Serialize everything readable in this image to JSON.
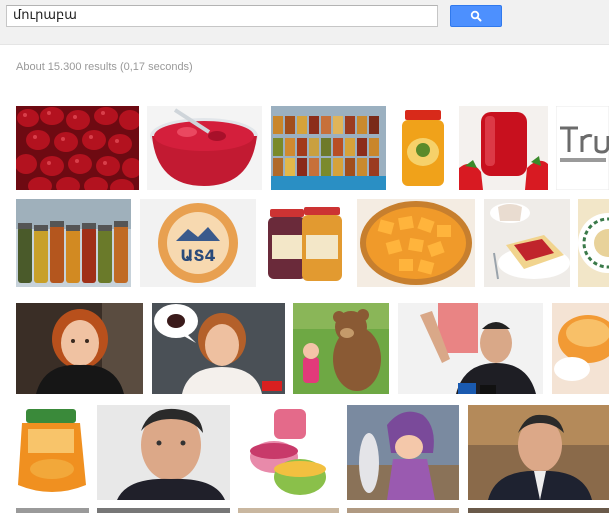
{
  "search": {
    "query": "մուրաբա"
  },
  "results": {
    "stats": "About 15.300 results (0,17 seconds)"
  },
  "images": [
    {
      "name": "image-red-cherries"
    },
    {
      "name": "image-cherry-jam-bowl"
    },
    {
      "name": "image-jam-jars-shelf"
    },
    {
      "name": "image-apricot-jam-jar"
    },
    {
      "name": "image-strawberry-jam-jar"
    },
    {
      "name": "image-logo-partial"
    },
    {
      "name": "image-preserve-jars-outdoor"
    },
    {
      "name": "image-orange-circle-logo"
    },
    {
      "name": "image-two-jam-jars"
    },
    {
      "name": "image-orange-cubes-bowl"
    },
    {
      "name": "image-jam-on-bread"
    },
    {
      "name": "image-patterned-plate"
    },
    {
      "name": "image-woman-red-hair"
    },
    {
      "name": "image-woman-speech-bubble"
    },
    {
      "name": "image-masha-and-bear"
    },
    {
      "name": "image-man-at-podium"
    },
    {
      "name": "image-orange-dessert"
    },
    {
      "name": "image-jam-jar-label"
    },
    {
      "name": "image-man-portrait"
    },
    {
      "name": "image-two-jar-containers"
    },
    {
      "name": "image-masha-cartoon"
    },
    {
      "name": "image-man-in-suit"
    }
  ]
}
